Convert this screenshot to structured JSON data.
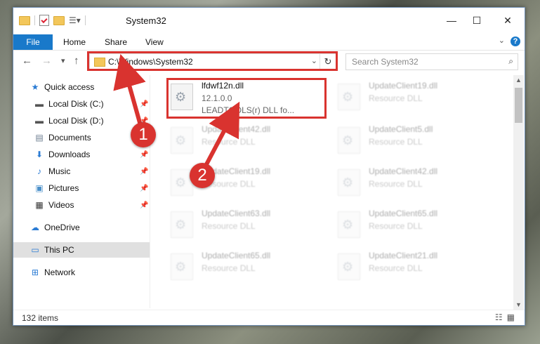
{
  "window": {
    "title": "System32",
    "minimize": "—",
    "maximize": "☐",
    "close": "✕"
  },
  "ribbon": {
    "file": "File",
    "tabs": [
      "Home",
      "Share",
      "View"
    ],
    "help": "?"
  },
  "nav": {
    "back": "←",
    "forward": "→",
    "recent": "▾",
    "up": "↑",
    "address": "C:\\Windows\\System32",
    "search_placeholder": "Search System32"
  },
  "sidebar": {
    "items": [
      {
        "label": "Quick access",
        "icon": "star-icon"
      },
      {
        "label": "Local Disk (C:)",
        "icon": "drive-icon",
        "pinned": true
      },
      {
        "label": "Local Disk (D:)",
        "icon": "drive-icon",
        "pinned": true
      },
      {
        "label": "Documents",
        "icon": "documents-icon",
        "pinned": true
      },
      {
        "label": "Downloads",
        "icon": "downloads-icon",
        "pinned": true
      },
      {
        "label": "Music",
        "icon": "music-icon",
        "pinned": true
      },
      {
        "label": "Pictures",
        "icon": "pictures-icon",
        "pinned": true
      },
      {
        "label": "Videos",
        "icon": "videos-icon",
        "pinned": true
      },
      {
        "label": "OneDrive",
        "icon": "cloud-icon"
      },
      {
        "label": "This PC",
        "icon": "computer-icon",
        "selected": true
      },
      {
        "label": "Network",
        "icon": "network-icon"
      }
    ]
  },
  "files": [
    {
      "name": "lfdwf12n.dll",
      "line2": "12.1.0.0",
      "line3": "LEADTOOLS(r) DLL fo...",
      "highlighted": true
    },
    {
      "name": "UpdateClient19.dll",
      "line2": "Resource DLL"
    },
    {
      "name": "UpdateClient42.dll",
      "line2": "Resource DLL"
    },
    {
      "name": "UpdateClient5.dll",
      "line2": "Resource DLL"
    },
    {
      "name": "UpdateClient19.dll",
      "line2": "Resource DLL"
    },
    {
      "name": "UpdateClient42.dll",
      "line2": "Resource DLL"
    },
    {
      "name": "UpdateClient63.dll",
      "line2": "Resource DLL"
    },
    {
      "name": "UpdateClient65.dll",
      "line2": "Resource DLL"
    },
    {
      "name": "UpdateClient65.dll",
      "line2": "Resource DLL"
    },
    {
      "name": "UpdateClient21.dll",
      "line2": "Resource DLL"
    }
  ],
  "status": {
    "count": "132 items"
  },
  "callouts": [
    "1",
    "2"
  ],
  "colors": {
    "accent": "#1979ca",
    "annotation": "#d9332f"
  }
}
